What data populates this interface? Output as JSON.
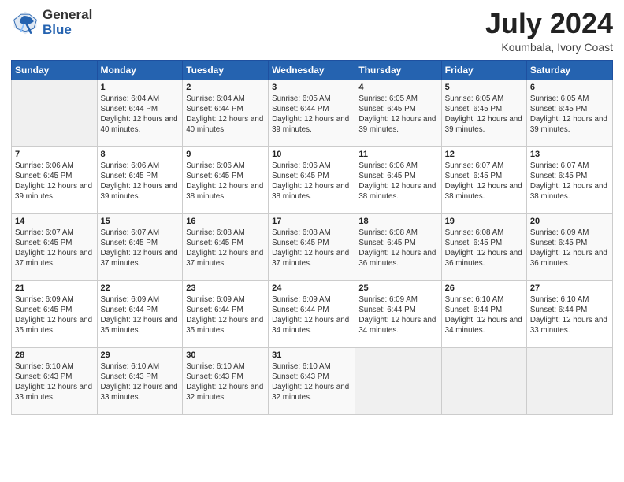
{
  "header": {
    "logo_general": "General",
    "logo_blue": "Blue",
    "title": "July 2024",
    "location": "Koumbala, Ivory Coast"
  },
  "days_of_week": [
    "Sunday",
    "Monday",
    "Tuesday",
    "Wednesday",
    "Thursday",
    "Friday",
    "Saturday"
  ],
  "weeks": [
    [
      {
        "day": "",
        "info": ""
      },
      {
        "day": "1",
        "info": "Sunrise: 6:04 AM\nSunset: 6:44 PM\nDaylight: 12 hours\nand 40 minutes."
      },
      {
        "day": "2",
        "info": "Sunrise: 6:04 AM\nSunset: 6:44 PM\nDaylight: 12 hours\nand 40 minutes."
      },
      {
        "day": "3",
        "info": "Sunrise: 6:05 AM\nSunset: 6:44 PM\nDaylight: 12 hours\nand 39 minutes."
      },
      {
        "day": "4",
        "info": "Sunrise: 6:05 AM\nSunset: 6:45 PM\nDaylight: 12 hours\nand 39 minutes."
      },
      {
        "day": "5",
        "info": "Sunrise: 6:05 AM\nSunset: 6:45 PM\nDaylight: 12 hours\nand 39 minutes."
      },
      {
        "day": "6",
        "info": "Sunrise: 6:05 AM\nSunset: 6:45 PM\nDaylight: 12 hours\nand 39 minutes."
      }
    ],
    [
      {
        "day": "7",
        "info": "Daylight: 12 hours\nand 39 minutes."
      },
      {
        "day": "8",
        "info": "Sunrise: 6:06 AM\nSunset: 6:45 PM\nDaylight: 12 hours\nand 39 minutes."
      },
      {
        "day": "9",
        "info": "Sunrise: 6:06 AM\nSunset: 6:45 PM\nDaylight: 12 hours\nand 38 minutes."
      },
      {
        "day": "10",
        "info": "Sunrise: 6:06 AM\nSunset: 6:45 PM\nDaylight: 12 hours\nand 38 minutes."
      },
      {
        "day": "11",
        "info": "Sunrise: 6:06 AM\nSunset: 6:45 PM\nDaylight: 12 hours\nand 38 minutes."
      },
      {
        "day": "12",
        "info": "Sunrise: 6:07 AM\nSunset: 6:45 PM\nDaylight: 12 hours\nand 38 minutes."
      },
      {
        "day": "13",
        "info": "Sunrise: 6:07 AM\nSunset: 6:45 PM\nDaylight: 12 hours\nand 38 minutes."
      }
    ],
    [
      {
        "day": "14",
        "info": "Sunrise: 6:07 AM\nSunset: 6:45 PM\nDaylight: 12 hours\nand 37 minutes."
      },
      {
        "day": "15",
        "info": "Sunrise: 6:07 AM\nSunset: 6:45 PM\nDaylight: 12 hours\nand 37 minutes."
      },
      {
        "day": "16",
        "info": "Sunrise: 6:08 AM\nSunset: 6:45 PM\nDaylight: 12 hours\nand 37 minutes."
      },
      {
        "day": "17",
        "info": "Sunrise: 6:08 AM\nSunset: 6:45 PM\nDaylight: 12 hours\nand 37 minutes."
      },
      {
        "day": "18",
        "info": "Sunrise: 6:08 AM\nSunset: 6:45 PM\nDaylight: 12 hours\nand 36 minutes."
      },
      {
        "day": "19",
        "info": "Sunrise: 6:08 AM\nSunset: 6:45 PM\nDaylight: 12 hours\nand 36 minutes."
      },
      {
        "day": "20",
        "info": "Sunrise: 6:09 AM\nSunset: 6:45 PM\nDaylight: 12 hours\nand 36 minutes."
      }
    ],
    [
      {
        "day": "21",
        "info": "Sunrise: 6:09 AM\nSunset: 6:45 PM\nDaylight: 12 hours\nand 35 minutes."
      },
      {
        "day": "22",
        "info": "Sunrise: 6:09 AM\nSunset: 6:44 PM\nDaylight: 12 hours\nand 35 minutes."
      },
      {
        "day": "23",
        "info": "Sunrise: 6:09 AM\nSunset: 6:44 PM\nDaylight: 12 hours\nand 35 minutes."
      },
      {
        "day": "24",
        "info": "Sunrise: 6:09 AM\nSunset: 6:44 PM\nDaylight: 12 hours\nand 34 minutes."
      },
      {
        "day": "25",
        "info": "Sunrise: 6:09 AM\nSunset: 6:44 PM\nDaylight: 12 hours\nand 34 minutes."
      },
      {
        "day": "26",
        "info": "Sunrise: 6:10 AM\nSunset: 6:44 PM\nDaylight: 12 hours\nand 34 minutes."
      },
      {
        "day": "27",
        "info": "Sunrise: 6:10 AM\nSunset: 6:44 PM\nDaylight: 12 hours\nand 33 minutes."
      }
    ],
    [
      {
        "day": "28",
        "info": "Sunrise: 6:10 AM\nSunset: 6:43 PM\nDaylight: 12 hours\nand 33 minutes."
      },
      {
        "day": "29",
        "info": "Sunrise: 6:10 AM\nSunset: 6:43 PM\nDaylight: 12 hours\nand 33 minutes."
      },
      {
        "day": "30",
        "info": "Sunrise: 6:10 AM\nSunset: 6:43 PM\nDaylight: 12 hours\nand 32 minutes."
      },
      {
        "day": "31",
        "info": "Sunrise: 6:10 AM\nSunset: 6:43 PM\nDaylight: 12 hours\nand 32 minutes."
      },
      {
        "day": "",
        "info": ""
      },
      {
        "day": "",
        "info": ""
      },
      {
        "day": "",
        "info": ""
      }
    ]
  ],
  "week1_special": {
    "7": "Sunrise: 6:06 AM\nSunset: 6:45 PM\nDaylight: 12 hours\nand 39 minutes."
  }
}
